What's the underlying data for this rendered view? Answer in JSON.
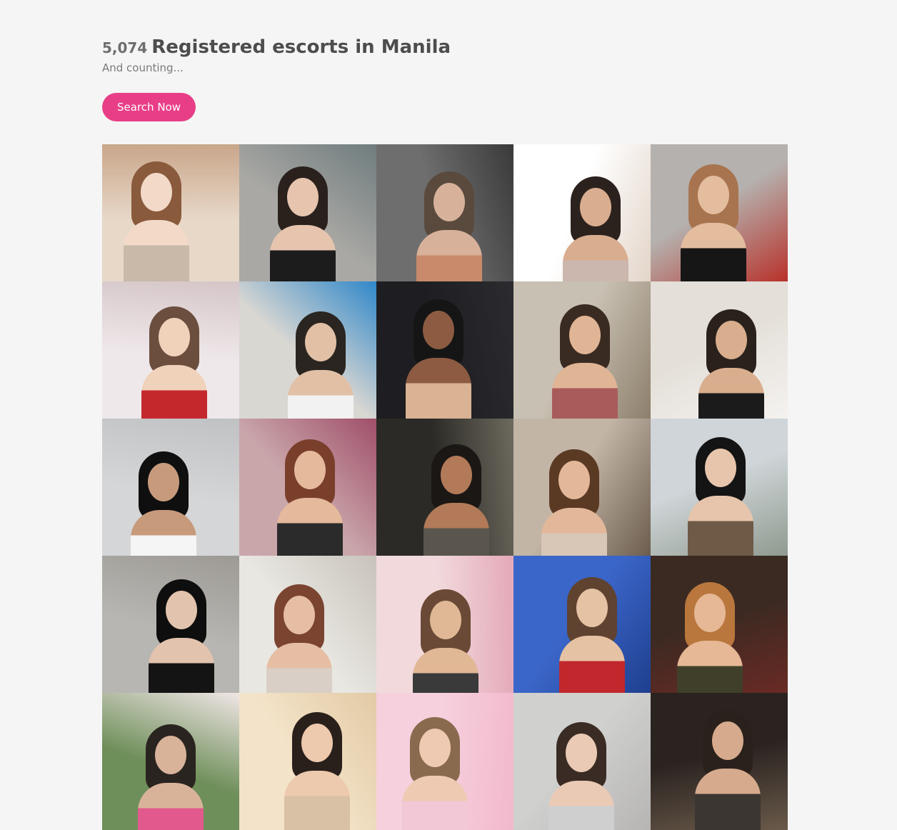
{
  "header": {
    "count": "5,074",
    "title": "Registered escorts in Manila",
    "subtitle": "And counting...",
    "search_button": "Search Now"
  },
  "colors": {
    "page_bg": "#f5f5f5",
    "accent": "#e83e87"
  },
  "gallery": {
    "tiles": [
      {
        "bg": "#e7d8c8",
        "bg2": "#c9a68a",
        "hair": "#8a5a3c",
        "skin": "#f2d9c8",
        "outfit": "#c8b9a8"
      },
      {
        "bg": "#a9a8a4",
        "bg2": "#6f7c7e",
        "hair": "#2a211d",
        "skin": "#e6c4ae",
        "outfit": "#1c1c1c"
      },
      {
        "bg": "#6e6e6e",
        "bg2": "#3a3a3a",
        "hair": "#5a4a3e",
        "skin": "#d7b19a",
        "outfit": "#c88a6a"
      },
      {
        "bg": "#ffffff",
        "bg2": "#e3d5c9",
        "hair": "#2b221e",
        "skin": "#d9ad8f",
        "outfit": "#cbb7ae"
      },
      {
        "bg": "#b5b1ae",
        "bg2": "#b8312a",
        "hair": "#a7744f",
        "skin": "#e4bd9f",
        "outfit": "#161616"
      },
      {
        "bg": "#efe8ea",
        "bg2": "#d5c6c8",
        "hair": "#6b4e3e",
        "skin": "#f0d2ba",
        "outfit": "#c4282d"
      },
      {
        "bg": "#d9d7d2",
        "bg2": "#2f87c9",
        "hair": "#2a2520",
        "skin": "#e1c0a6",
        "outfit": "#f2f2f2"
      },
      {
        "bg": "#1e1e22",
        "bg2": "#2b2b30",
        "hair": "#151515",
        "skin": "#8c5b41",
        "outfit": "#d9b394"
      },
      {
        "bg": "#c8c0b2",
        "bg2": "#8d7f6c",
        "hair": "#3a2b22",
        "skin": "#e0b595",
        "outfit": "#a95b5b"
      },
      {
        "bg": "#e4dfd8",
        "bg2": "#f4f2f0",
        "hair": "#2a211c",
        "skin": "#d9ae8e",
        "outfit": "#1b1b1b"
      },
      {
        "bg": "#d5d6d7",
        "bg2": "#bfc1c3",
        "hair": "#0f0f10",
        "skin": "#c79a7c",
        "outfit": "#f5f5f5"
      },
      {
        "bg": "#c9a6aa",
        "bg2": "#a04f6a",
        "hair": "#7a3f2b",
        "skin": "#e5b99c",
        "outfit": "#2b2b2b"
      },
      {
        "bg": "#2b2a26",
        "bg2": "#6d6a5e",
        "hair": "#1b1714",
        "skin": "#b27a58",
        "outfit": "#5a564e"
      },
      {
        "bg": "#c2b5a6",
        "bg2": "#6c5d4e",
        "hair": "#5b3a24",
        "skin": "#e3b89a",
        "outfit": "#d8c7b6"
      },
      {
        "bg": "#cfd5d8",
        "bg2": "#8f9a8f",
        "hair": "#141414",
        "skin": "#e7c5ac",
        "outfit": "#6f5a48"
      },
      {
        "bg": "#b8b6b2",
        "bg2": "#9d9a95",
        "hair": "#0e0e0e",
        "skin": "#e2c3ad",
        "outfit": "#141414"
      },
      {
        "bg": "#e9e7e2",
        "bg2": "#c8c3bb",
        "hair": "#7a4431",
        "skin": "#e6bea3",
        "outfit": "#d9cfc6"
      },
      {
        "bg": "#f1d9dc",
        "bg2": "#e4a9b8",
        "hair": "#6a4a36",
        "skin": "#e1b895",
        "outfit": "#3a3a3a"
      },
      {
        "bg": "#3b66c9",
        "bg2": "#1f3f8f",
        "hair": "#5f4330",
        "skin": "#e6c2a4",
        "outfit": "#c0282e"
      },
      {
        "bg": "#3a2a22",
        "bg2": "#6a2a24",
        "hair": "#b9773d",
        "skin": "#e6b896",
        "outfit": "#40402a"
      },
      {
        "bg": "#6f8f5a",
        "bg2": "#f0e6e6",
        "hair": "#2a2420",
        "skin": "#d8b39a",
        "outfit": "#e25a8d"
      },
      {
        "bg": "#f3e3c8",
        "bg2": "#e2caa5",
        "hair": "#2a201b",
        "skin": "#edc9ad",
        "outfit": "#d8c1a4"
      },
      {
        "bg": "#f6d0dd",
        "bg2": "#f2b9cc",
        "hair": "#8a6a4f",
        "skin": "#edcab1",
        "outfit": "#f2c8d6"
      },
      {
        "bg": "#d0d0cf",
        "bg2": "#b6b5b3",
        "hair": "#3a2c24",
        "skin": "#eacab5",
        "outfit": "#cfcfcf"
      },
      {
        "bg": "#2a2320",
        "bg2": "#6a5a4a",
        "hair": "#2a211c",
        "skin": "#d6aa8c",
        "outfit": "#3c3632"
      }
    ]
  }
}
